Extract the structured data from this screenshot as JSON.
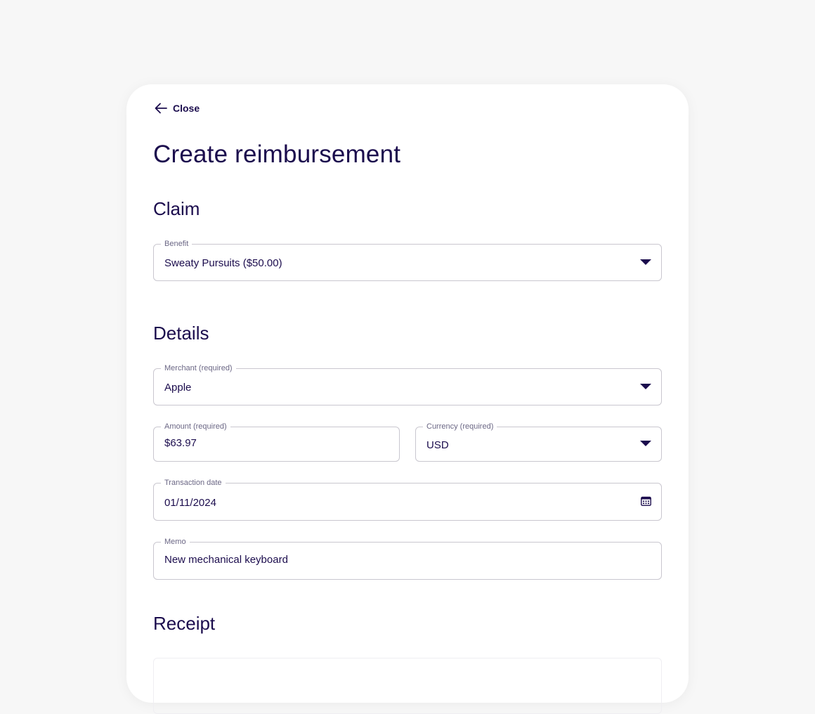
{
  "close_label": "Close",
  "page_title": "Create reimbursement",
  "sections": {
    "claim": "Claim",
    "details": "Details",
    "receipt": "Receipt"
  },
  "fields": {
    "benefit": {
      "label": "Benefit",
      "value": "Sweaty Pursuits ($50.00)"
    },
    "merchant": {
      "label": "Merchant (required)",
      "value": "Apple"
    },
    "amount": {
      "label": "Amount (required)",
      "value": "$63.97"
    },
    "currency": {
      "label": "Currency (required)",
      "value": "USD"
    },
    "transaction_date": {
      "label": "Transaction date",
      "value": "01/11/2024"
    },
    "memo": {
      "label": "Memo",
      "value": "New mechanical keyboard"
    }
  },
  "icons": {
    "close": "arrow-left-icon",
    "dropdown": "caret-down-icon",
    "date": "calendar-icon"
  },
  "colors": {
    "text": "#1b0c4d",
    "background": "#f7f7f7",
    "card": "#ffffff",
    "border": "#c9c7cf"
  }
}
